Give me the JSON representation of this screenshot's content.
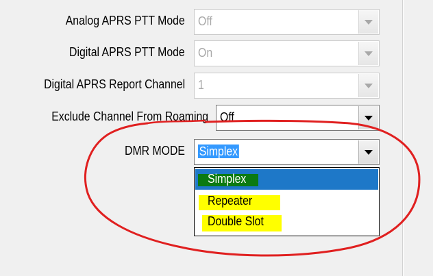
{
  "fields": [
    {
      "label": "Analog APRS PTT Mode",
      "value": "Off",
      "enabled": false
    },
    {
      "label": "Digital APRS PTT Mode",
      "value": "On",
      "enabled": false
    },
    {
      "label": "Digital APRS Report Channel",
      "value": "1",
      "enabled": false
    },
    {
      "label": "Exclude Channel From Roaming",
      "value": "Off",
      "enabled": true
    },
    {
      "label": "DMR MODE",
      "value": "Simplex",
      "enabled": true
    }
  ],
  "dropdown": {
    "options": [
      "Simplex",
      "Repeater",
      "Double Slot"
    ],
    "selected": "Simplex"
  },
  "annotation": {
    "color": "#e02020",
    "highlight_color": "#ffff00"
  }
}
